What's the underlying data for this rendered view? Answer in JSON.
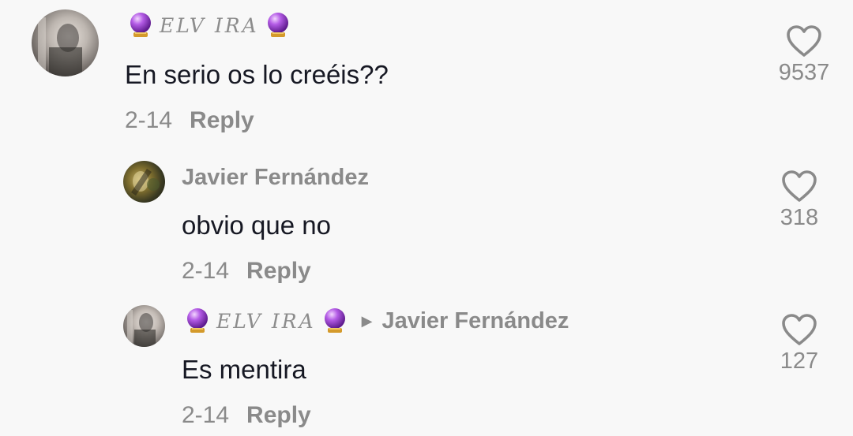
{
  "comments": [
    {
      "username_styled": "ELV IRA",
      "text": "En serio os lo creéis??",
      "date": "2-14",
      "reply_label": "Reply",
      "likes": "9537"
    },
    {
      "username": "Javier Fernández",
      "text": "obvio que no",
      "date": "2-14",
      "reply_label": "Reply",
      "likes": "318"
    },
    {
      "username_styled": "ELV IRA",
      "reply_to": "Javier Fernández",
      "text": "Es mentira",
      "date": "2-14",
      "reply_label": "Reply",
      "likes": "127"
    }
  ],
  "icons": {
    "orb": "crystal-ball-icon",
    "like": "heart-outline-icon",
    "reply_arrow": "right-triangle-icon"
  },
  "colors": {
    "background": "#f8f8f8",
    "primary_text": "#161823",
    "secondary_text": "#8a8a8a",
    "orb_purple": "#9b3fd1"
  }
}
